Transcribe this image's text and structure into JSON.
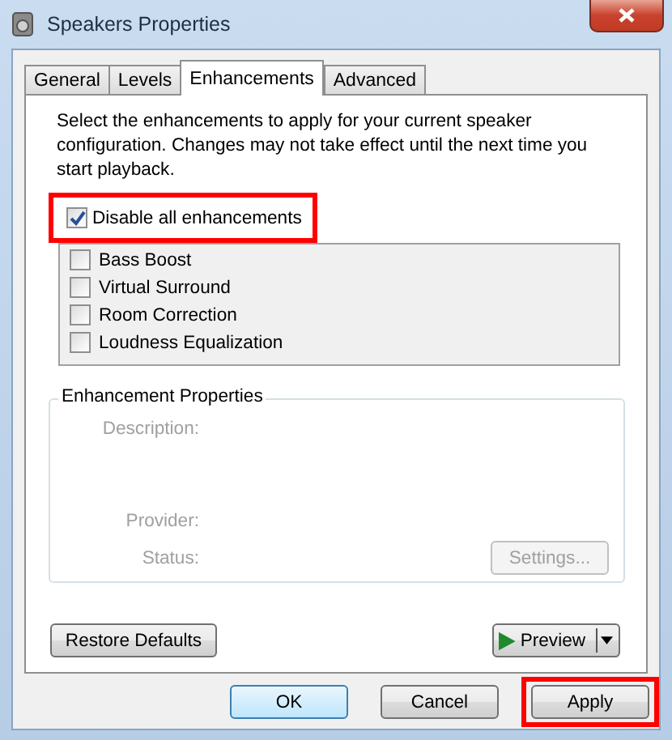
{
  "window": {
    "title": "Speakers Properties"
  },
  "tabs": [
    {
      "label": "General",
      "selected": false
    },
    {
      "label": "Levels",
      "selected": false
    },
    {
      "label": "Enhancements",
      "selected": true
    },
    {
      "label": "Advanced",
      "selected": false
    }
  ],
  "intro": "Select the enhancements to apply for your current speaker configuration. Changes may not take effect until the next time you start playback.",
  "disable_all": {
    "label": "Disable all enhancements",
    "checked": true,
    "highlighted": true
  },
  "enhancements": [
    {
      "label": "Bass Boost",
      "checked": false,
      "disabled": false
    },
    {
      "label": "Virtual Surround",
      "checked": false,
      "disabled": false
    },
    {
      "label": "Room Correction",
      "checked": false,
      "disabled": false
    },
    {
      "label": "Loudness Equalization",
      "checked": false,
      "disabled": false
    }
  ],
  "properties": {
    "title": "Enhancement Properties",
    "fields": [
      "Description:",
      "Provider:",
      "Status:"
    ],
    "settings_button": {
      "label": "Settings...",
      "disabled": true
    }
  },
  "restore_button": "Restore Defaults",
  "preview_button": "Preview",
  "buttons": [
    {
      "label": "OK",
      "default": true,
      "highlighted": false
    },
    {
      "label": "Cancel",
      "default": false,
      "highlighted": false
    },
    {
      "label": "Apply",
      "default": false,
      "highlighted": true
    }
  ]
}
